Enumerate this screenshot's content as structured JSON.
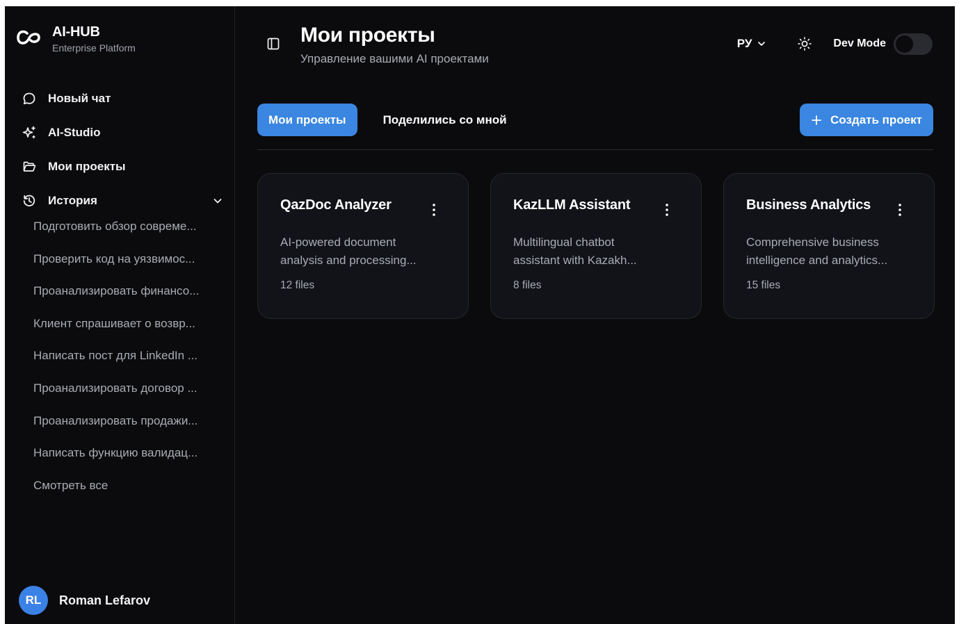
{
  "brand": {
    "title": "AI-HUB",
    "subtitle": "Enterprise Platform",
    "logo_icon": "infinity-logo-icon"
  },
  "sidebar": {
    "nav": [
      {
        "label": "Новый чат",
        "icon": "chat-bubble-icon"
      },
      {
        "label": "AI-Studio",
        "icon": "sparkles-icon"
      },
      {
        "label": "Мои проекты",
        "icon": "folder-open-icon"
      },
      {
        "label": "История",
        "icon": "history-icon",
        "expanded": true
      }
    ],
    "history": [
      "Подготовить обзор совреме...",
      "Проверить код на уязвимос...",
      "Проанализировать финансо...",
      "Клиент спрашивает о возвр...",
      "Написать пост для LinkedIn ...",
      "Проанализировать договор ...",
      "Проанализировать продажи...",
      "Написать функцию валидац..."
    ],
    "see_all": "Смотреть все"
  },
  "user": {
    "initials": "RL",
    "name": "Roman Lefarov"
  },
  "header": {
    "title": "Мои проекты",
    "subtitle": "Управление вашими AI проектами",
    "language": "РУ",
    "dev_mode_label": "Dev Mode",
    "dev_mode_on": false
  },
  "tabs": [
    {
      "label": "Мои проекты",
      "active": true
    },
    {
      "label": "Поделились со мной",
      "active": false
    }
  ],
  "create_button": "Создать проект",
  "projects": [
    {
      "title": "QazDoc Analyzer",
      "desc_line1": "AI-powered document",
      "desc_line2": "analysis and processing...",
      "files": "12 files"
    },
    {
      "title": "KazLLM Assistant",
      "desc_line1": "Multilingual chatbot",
      "desc_line2": "assistant with Kazakh...",
      "files": "8 files"
    },
    {
      "title": "Business Analytics",
      "desc_line1": "Comprehensive business",
      "desc_line2": "intelligence and analytics...",
      "files": "15 files"
    }
  ],
  "colors": {
    "background": "#0b0b0d",
    "accent": "#3a86e0",
    "card": "#121318",
    "muted_text": "#a9acb5"
  }
}
